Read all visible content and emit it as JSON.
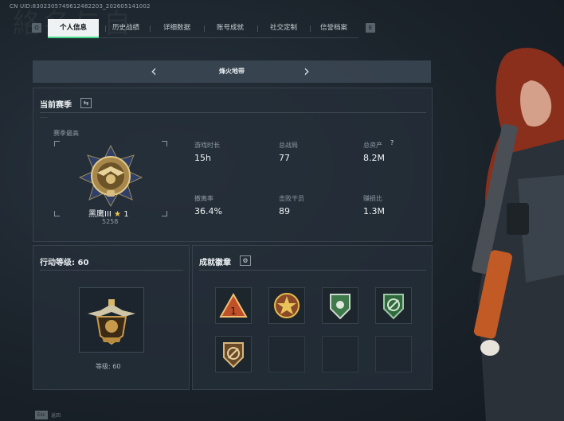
{
  "uid": "CN UID:8302305749612482203_202605141002",
  "ghost_text": "絡名与自",
  "tabs": {
    "prev_key": "Q",
    "next_key": "E",
    "items": [
      {
        "label": "个人信息",
        "active": true
      },
      {
        "label": "历史战绩",
        "active": false
      },
      {
        "label": "详细数据",
        "active": false
      },
      {
        "label": "账号成就",
        "active": false
      },
      {
        "label": "社交定制",
        "active": false
      },
      {
        "label": "信誉档案",
        "active": false
      }
    ]
  },
  "mode": {
    "title": "烽火地带",
    "prev_icon": "chevron-left-icon",
    "next_icon": "chevron-right-icon"
  },
  "season": {
    "title": "当前赛季",
    "highest_label": "赛季最高",
    "rank_name": "黑鹰III",
    "rank_stars": "1",
    "rank_score": "5258",
    "stats": [
      {
        "label": "游戏时长",
        "value": "15h"
      },
      {
        "label": "总战局",
        "value": "77"
      },
      {
        "label": "总资产",
        "value": "8.2M",
        "help": "?"
      },
      {
        "label": "撤离率",
        "value": "36.4%"
      },
      {
        "label": "击败干员",
        "value": "89"
      },
      {
        "label": "赚损比",
        "value": "1.3M"
      }
    ]
  },
  "level": {
    "title": "行动等级: 60",
    "caption": "等级: 60"
  },
  "achievements": {
    "title": "成就徽章",
    "badges": [
      {
        "icon": "red-triangle-badge-icon"
      },
      {
        "icon": "gold-star-medal-icon"
      },
      {
        "icon": "green-shield-badge-icon"
      },
      {
        "icon": "green-compass-badge-icon"
      },
      {
        "icon": "bronze-shield-badge-icon"
      },
      {
        "icon": ""
      },
      {
        "icon": ""
      },
      {
        "icon": ""
      }
    ]
  },
  "footer": {
    "key": "Esc",
    "label": "返回"
  },
  "colors": {
    "accent": "#3de08a",
    "active_tab_bg": "#eef2f2",
    "panel_bg": "#242e38"
  }
}
